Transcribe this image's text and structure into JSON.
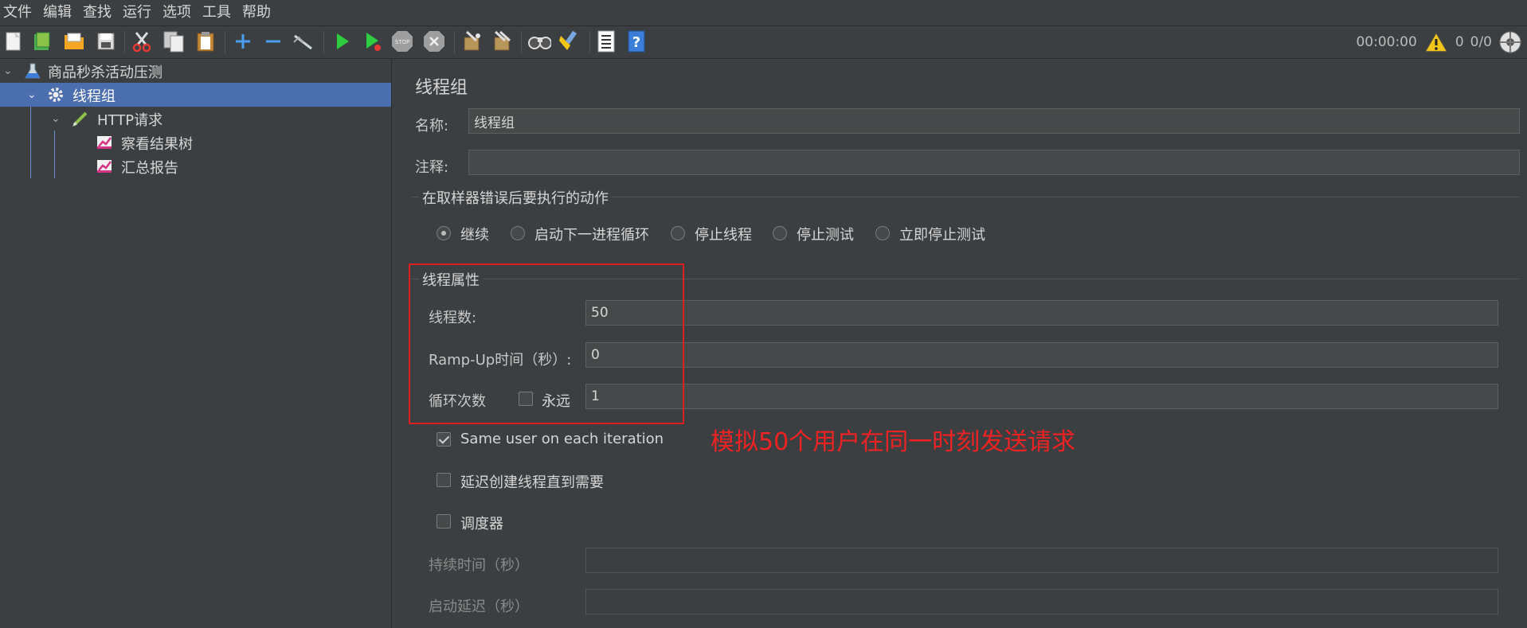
{
  "menubar": {
    "items": [
      "文件",
      "编辑",
      "查找",
      "运行",
      "选项",
      "工具",
      "帮助"
    ]
  },
  "toolbar": {
    "icons": [
      "new-icon",
      "templates-icon",
      "open-icon",
      "save-icon",
      "cut-icon",
      "copy-icon",
      "paste-icon",
      "add-icon",
      "remove-icon",
      "toggle-icon",
      "start-icon",
      "start-no-pause-icon",
      "stop-icon",
      "shutdown-icon",
      "clear-icon",
      "clear-all-icon",
      "search-icon",
      "reset-search-icon",
      "function-helper-icon",
      "help-icon"
    ],
    "timer": "00:00:00",
    "warning_count": "0",
    "threads": "0/0"
  },
  "tree": {
    "items": [
      {
        "label": "商品秒杀活动压测",
        "icon": "test-plan-icon"
      },
      {
        "label": "线程组",
        "icon": "gear-icon"
      },
      {
        "label": "HTTP请求",
        "icon": "sampler-pen-icon"
      },
      {
        "label": "察看结果树",
        "icon": "listener-chart-icon"
      },
      {
        "label": "汇总报告",
        "icon": "listener-chart-icon"
      }
    ]
  },
  "panel": {
    "title": "线程组",
    "name_label": "名称:",
    "name_value": "线程组",
    "comment_label": "注释:",
    "comment_value": "",
    "error_action": {
      "title": "在取样器错误后要执行的动作",
      "options": [
        "继续",
        "启动下一进程循环",
        "停止线程",
        "停止测试",
        "立即停止测试"
      ],
      "selected": "继续"
    },
    "thread_props": {
      "title": "线程属性",
      "threads_label": "线程数:",
      "threads_value": "50",
      "rampup_label": "Ramp-Up时间（秒）:",
      "rampup_value": "0",
      "loop_label": "循环次数",
      "forever_label": "永远",
      "forever_checked": false,
      "loop_value": "1"
    },
    "same_user_label": "Same user on each iteration",
    "same_user_checked": true,
    "delay_create_label": "延迟创建线程直到需要",
    "delay_create_checked": false,
    "scheduler_label": "调度器",
    "scheduler_checked": false,
    "duration_label": "持续时间（秒）",
    "duration_value": "",
    "startup_delay_label": "启动延迟（秒）",
    "startup_delay_value": ""
  },
  "annotation": "模拟50个用户在同一时刻发送请求",
  "colors": {
    "background": "#3c3f41",
    "selection": "#4b6eaf",
    "annotation": "#ee2222",
    "warning": "#f0c419"
  }
}
